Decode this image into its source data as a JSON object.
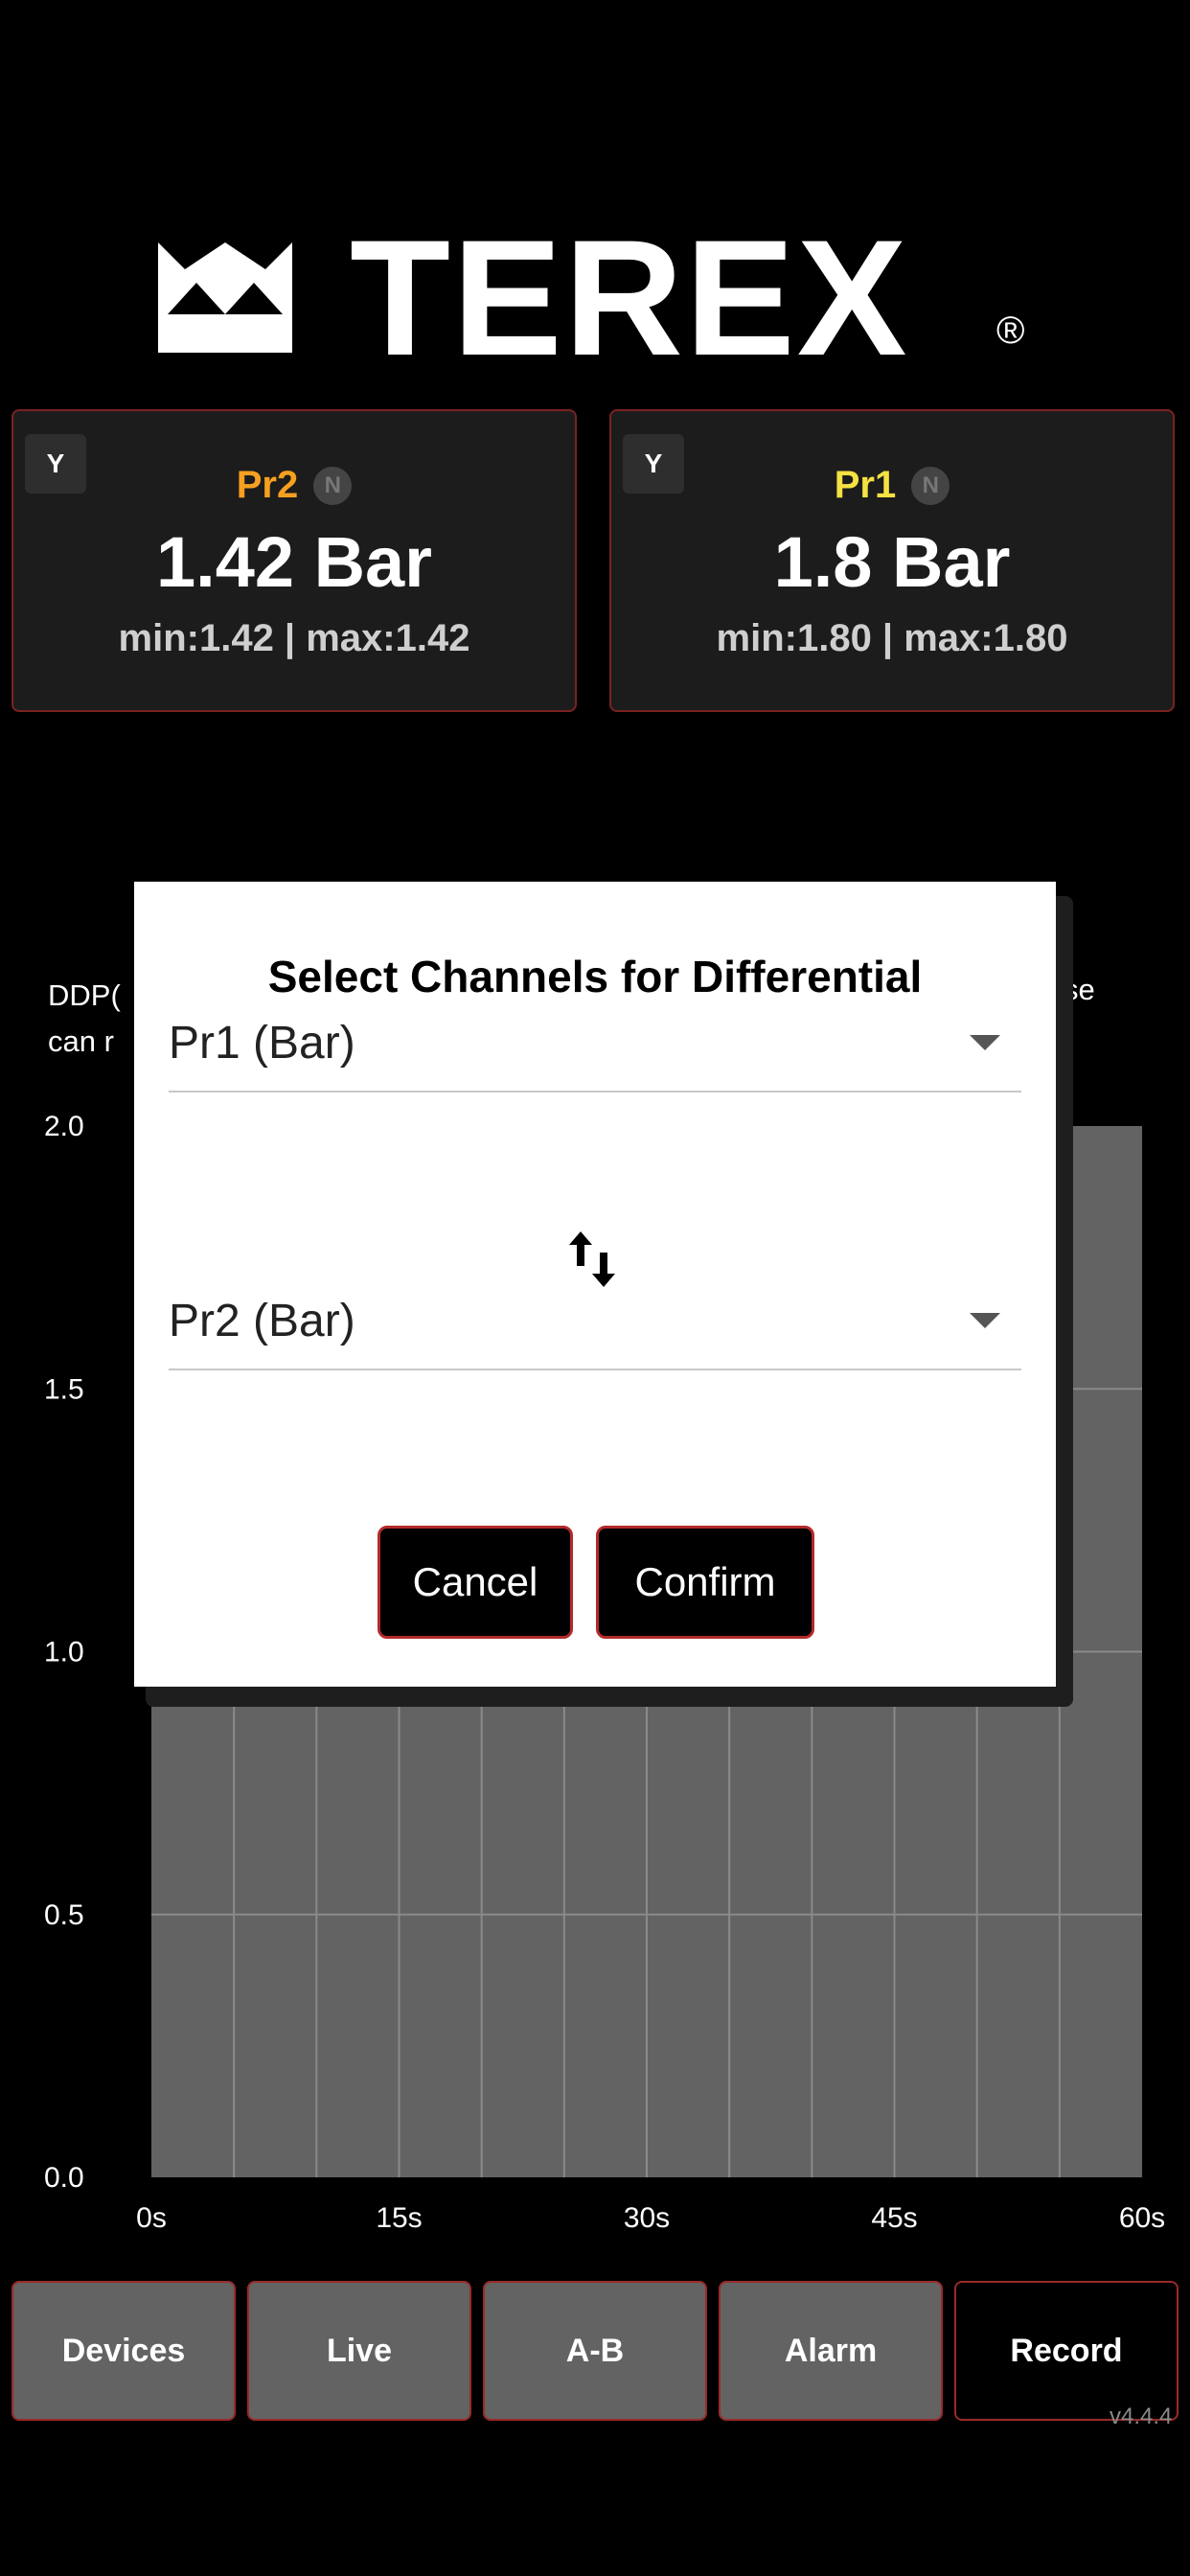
{
  "brand": {
    "logo_text": "TEREX",
    "registered_mark": "®"
  },
  "channels": [
    {
      "badge": "Y",
      "name": "Pr2",
      "name_color": "#f5a021",
      "status_badge": "N",
      "value": "1.42 Bar",
      "minmax": "min:1.42 | max:1.42"
    },
    {
      "badge": "Y",
      "name": "Pr1",
      "name_color": "#f5e142",
      "status_badge": "N",
      "value": "1.8 Bar",
      "minmax": "min:1.80 | max:1.80"
    }
  ],
  "partial_note": {
    "line1": "DDP(",
    "line2": "can r",
    "line_right": "se"
  },
  "chart_data": {
    "type": "area",
    "x": [
      0,
      15,
      30,
      45,
      60
    ],
    "xtick_labels": [
      "0s",
      "15s",
      "30s",
      "45s",
      "60s"
    ],
    "ytick_labels": [
      "2.0",
      "1.5",
      "1.0",
      "0.5",
      "0.0"
    ],
    "ylim": [
      0,
      2
    ],
    "xlim": [
      0,
      60
    ],
    "grid": true,
    "fill_color": "#636363",
    "grid_color": "#8a8a8a"
  },
  "dialog": {
    "title": "Select Channels for Differential",
    "select_a": "Pr1 (Bar)",
    "select_b": "Pr2 (Bar)",
    "swap_icon": "swap-vertical-icon",
    "cancel_label": "Cancel",
    "confirm_label": "Confirm"
  },
  "nav": {
    "items": [
      {
        "label": "Devices",
        "active": false
      },
      {
        "label": "Live",
        "active": false
      },
      {
        "label": "A-B",
        "active": false
      },
      {
        "label": "Alarm",
        "active": false
      },
      {
        "label": "Record",
        "active": true
      }
    ]
  },
  "version": "v4.4.4",
  "colors": {
    "card_border": "#7a2222",
    "button_border": "#b22a2a",
    "accent_pr2": "#f5a021",
    "accent_pr1": "#f5e142"
  }
}
